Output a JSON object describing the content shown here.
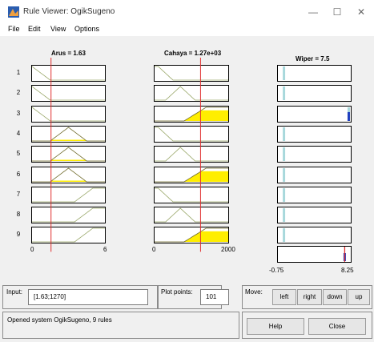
{
  "window": {
    "title": "Rule Viewer: OgikSugeno",
    "controls": {
      "minimize": "—",
      "maximize": "☐",
      "close": "✕"
    }
  },
  "menu": [
    "File",
    "Edit",
    "View",
    "Options"
  ],
  "variables": {
    "arus_title": "Arus = 1.63",
    "cahaya_title": "Cahaya = 1.27e+03",
    "wiper_title": "Wiper = 7.5"
  },
  "rows": [
    "1",
    "2",
    "3",
    "4",
    "5",
    "6",
    "7",
    "8",
    "9"
  ],
  "axes": {
    "arus_min": "0",
    "arus_max": "6",
    "cahaya_min": "0",
    "cahaya_max": "2000",
    "wiper_min": "-0.75",
    "wiper_max": "8.25"
  },
  "plot_values": {
    "arus": {
      "range": [
        0,
        6
      ],
      "current": 1.63,
      "mfs": [
        {
          "type": "zmf",
          "params": [
            0,
            1.5
          ]
        },
        {
          "type": "trimf",
          "params": [
            1.5,
            3,
            4.5
          ]
        },
        {
          "type": "smf",
          "params": [
            3.5,
            5
          ]
        }
      ],
      "rule_mf": [
        0,
        0,
        0,
        1,
        1,
        1,
        2,
        2,
        2
      ]
    },
    "cahaya": {
      "range": [
        0,
        2000
      ],
      "current": 1270,
      "mfs": [
        {
          "type": "zmf",
          "params": [
            100,
            500
          ]
        },
        {
          "type": "trimf",
          "params": [
            300,
            700,
            1100
          ]
        },
        {
          "type": "smf",
          "params": [
            800,
            1400
          ]
        }
      ],
      "rule_mf": [
        0,
        1,
        2,
        0,
        1,
        2,
        0,
        1,
        2
      ]
    },
    "wiper": {
      "range": [
        -0.75,
        8.25
      ],
      "current": 7.5,
      "outputs": [
        0,
        0,
        8,
        0,
        0,
        0,
        0,
        0,
        0
      ],
      "strengths": [
        0,
        0,
        0.65,
        0,
        0,
        0,
        0,
        0,
        0
      ]
    }
  },
  "controls": {
    "input_label": "Input:",
    "input_value": "[1.63;1270]",
    "plot_points_label": "Plot points:",
    "plot_points_value": "101",
    "move_label": "Move:",
    "left": "left",
    "right": "right",
    "down": "down",
    "up": "up",
    "status": "Opened system OgikSugeno, 9 rules",
    "help": "Help",
    "close": "Close"
  },
  "colors": {
    "fill": "#ffee00",
    "index_line": "#e03030",
    "output_bar": "#a8d8dc",
    "output_fill": "#1f3fbf",
    "mf_line": "#9aa86a"
  }
}
